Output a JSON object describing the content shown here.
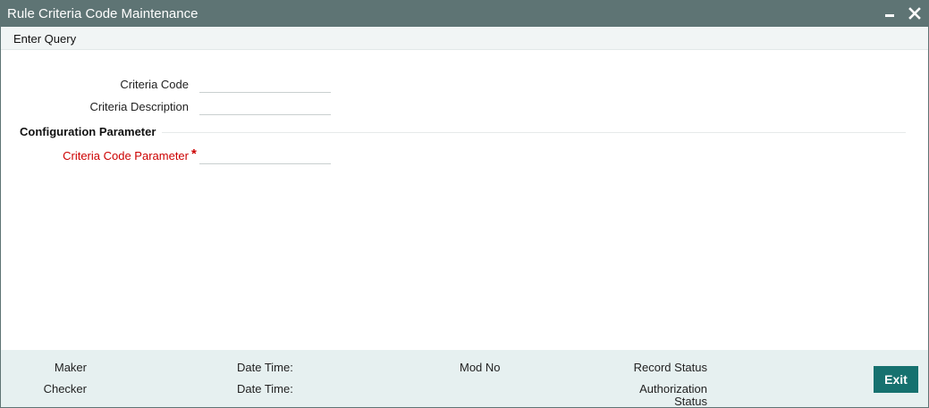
{
  "window": {
    "title": "Rule Criteria Code Maintenance"
  },
  "menu": {
    "enter_query": "Enter Query"
  },
  "form": {
    "criteria_code_label": "Criteria Code",
    "criteria_code_value": "",
    "criteria_description_label": "Criteria Description",
    "criteria_description_value": "",
    "section_title": "Configuration Parameter",
    "criteria_code_parameter_label": "Criteria Code Parameter",
    "criteria_code_parameter_value": "",
    "required_marker": "*"
  },
  "footer": {
    "maker": "Maker",
    "checker": "Checker",
    "date_time_1": "Date Time:",
    "date_time_2": "Date Time:",
    "mod_no": "Mod No",
    "record_status": "Record Status",
    "authorization_line1": "Authorization",
    "authorization_line2": "Status",
    "exit": "Exit"
  },
  "colors": {
    "titlebar": "#5e7474",
    "required": "#cc0000",
    "exit_button": "#16716f",
    "footer_bg": "#e6f0f0"
  },
  "icons": {
    "minimize": "minimize-icon",
    "close": "close-icon"
  }
}
